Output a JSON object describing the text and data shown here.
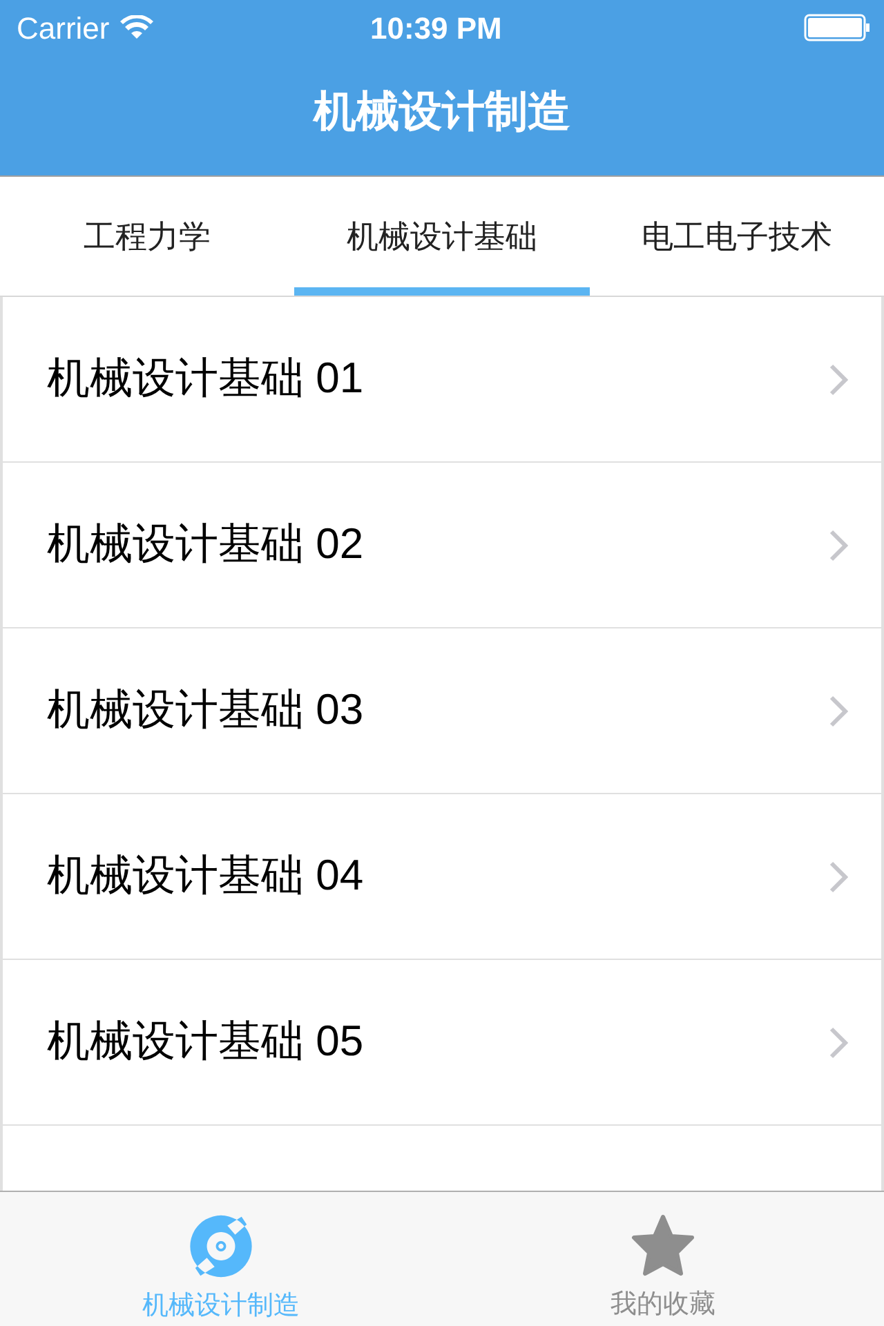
{
  "status_bar": {
    "carrier": "Carrier",
    "time": "10:39 PM"
  },
  "nav_bar": {
    "title": "机械设计制造"
  },
  "tabs": [
    {
      "label": "工程力学",
      "selected": false
    },
    {
      "label": "机械设计基础",
      "selected": true
    },
    {
      "label": "电工电子技术",
      "selected": false
    }
  ],
  "list": {
    "items": [
      {
        "title": "机械设计基础 01"
      },
      {
        "title": "机械设计基础 02"
      },
      {
        "title": "机械设计基础 03"
      },
      {
        "title": "机械设计基础 04"
      },
      {
        "title": "机械设计基础 05"
      }
    ]
  },
  "tab_bar": [
    {
      "kind": "disc",
      "label": "机械设计制造",
      "selected": true
    },
    {
      "kind": "star",
      "label": "我的收藏",
      "selected": false
    }
  ]
}
